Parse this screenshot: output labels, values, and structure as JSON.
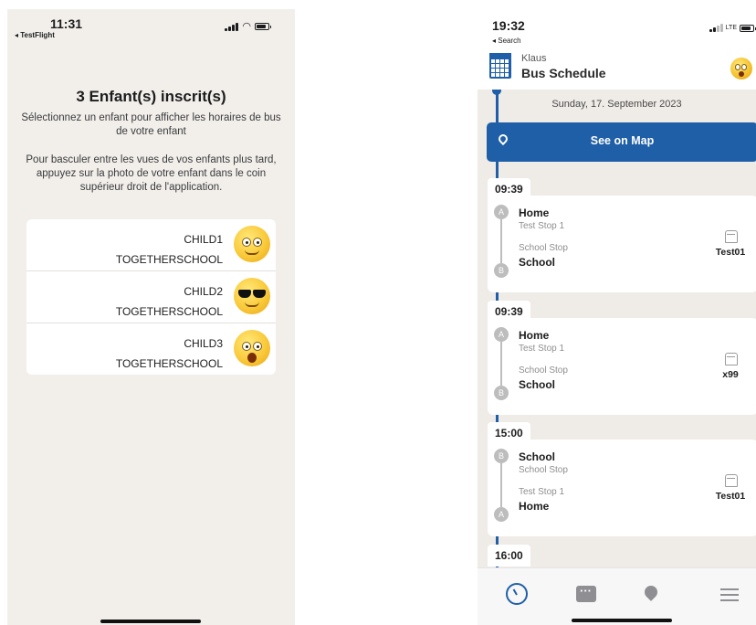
{
  "left": {
    "status_bar": {
      "time": "11:31",
      "back_label": "◂ TestFlight"
    },
    "title": "3 Enfant(s) inscrit(s)",
    "description_1": "Sélectionnez un enfant pour afficher les horaires de bus de votre enfant",
    "description_2": "Pour basculer entre les vues de vos enfants plus tard, appuyez sur la photo de votre enfant dans le coin supérieur droit de l'application.",
    "children": [
      {
        "name": "CHILD1",
        "school": "TOGETHERSCHOOL",
        "avatar": "smiling-emoji-icon"
      },
      {
        "name": "CHILD2",
        "school": "TOGETHERSCHOOL",
        "avatar": "sunglasses-emoji-icon"
      },
      {
        "name": "CHILD3",
        "school": "TOGETHERSCHOOL",
        "avatar": "surprised-emoji-icon"
      }
    ]
  },
  "right": {
    "status_bar": {
      "time": "19:32",
      "back_label": "◂ Search",
      "network": "LTE"
    },
    "header": {
      "user": "Klaus",
      "title": "Bus Schedule"
    },
    "date": "Sunday, 17. September 2023",
    "map_button": "See on Map",
    "trips": [
      {
        "time": "09:39",
        "from_letter": "A",
        "from_name": "Home",
        "from_sub": "Test Stop 1",
        "to_letter": "B",
        "to_sub": "School Stop",
        "to_name": "School",
        "bus": "Test01"
      },
      {
        "time": "09:39",
        "from_letter": "A",
        "from_name": "Home",
        "from_sub": "Test Stop 1",
        "to_letter": "B",
        "to_sub": "School Stop",
        "to_name": "School",
        "bus": "x99"
      },
      {
        "time": "15:00",
        "from_letter": "B",
        "from_name": "School",
        "from_sub": "School Stop",
        "to_letter": "A",
        "to_sub": "Test Stop 1",
        "to_name": "Home",
        "bus": "Test01"
      }
    ],
    "next_time": "16:00",
    "tabs": [
      "schedule-icon",
      "chat-icon",
      "map-pin-icon",
      "menu-icon"
    ]
  },
  "colors": {
    "accent": "#1f5fa8",
    "left_bg": "#f2efeb",
    "right_bg": "#efebe6"
  }
}
